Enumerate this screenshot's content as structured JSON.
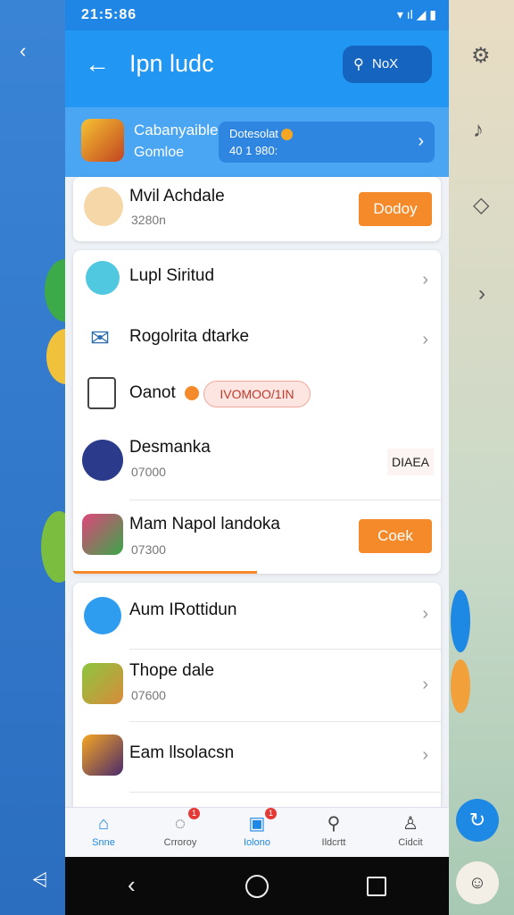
{
  "status": {
    "time": "21:5:86",
    "icons": "▾ ıl ◢ ▮"
  },
  "header": {
    "title": "Ipn ludc",
    "search_placeholder": "NoX"
  },
  "banner": {
    "name_line1": "Cabanyaible",
    "name_line2": "Gomloe",
    "stat_line1": "Dotesolat",
    "stat_line2": "40 1 980:"
  },
  "card1": {
    "title": "Mvil Achdale",
    "subtitle": "3280n",
    "button": "Dodoy"
  },
  "card2": {
    "rows": [
      {
        "title": "Lupl Siritud"
      },
      {
        "title": "Rogolrita dtarke"
      },
      {
        "title": "Oanot",
        "pill": "IVOMOO/1IN"
      },
      {
        "title": "Desmanka",
        "subtitle": "07000",
        "tag": "DIAEA"
      },
      {
        "title": "Mam Napol landoka",
        "subtitle": "07300",
        "button": "Coek"
      }
    ],
    "progress_fraction": 0.5
  },
  "card3": {
    "rows": [
      {
        "title": "Aum IRottidun"
      },
      {
        "title": "Thope dale",
        "subtitle": "07600"
      },
      {
        "title": "Eam llsolacsn"
      }
    ]
  },
  "tabs": [
    {
      "label": "Snne",
      "icon": "home-icon",
      "active": true
    },
    {
      "label": "Crroroy",
      "icon": "chat-icon",
      "badge": "1"
    },
    {
      "label": "Iolono",
      "icon": "store-icon",
      "badge": "1",
      "active": true
    },
    {
      "label": "Ildcrtt",
      "icon": "search-icon"
    },
    {
      "label": "Cidcit",
      "icon": "profile-icon"
    }
  ],
  "colors": {
    "primary": "#2196f3",
    "accent": "#f48a2a",
    "nav": "#0a0a0a"
  }
}
